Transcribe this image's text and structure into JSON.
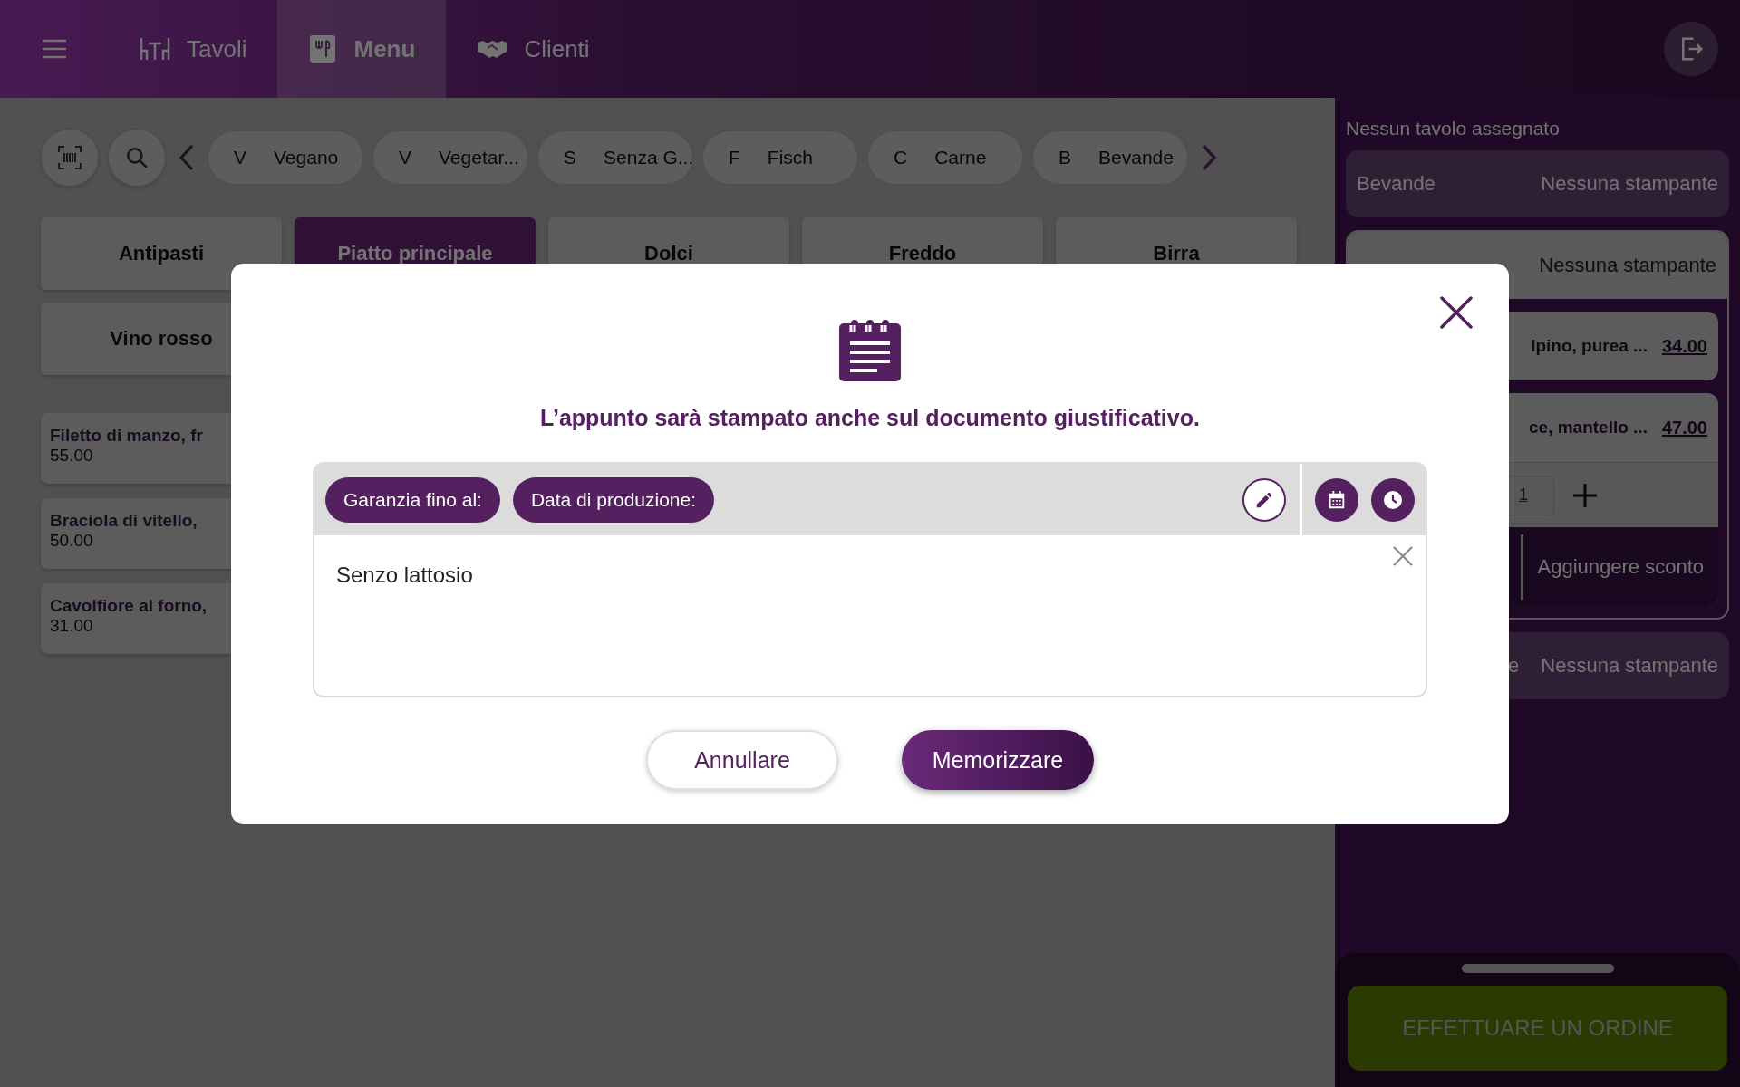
{
  "top_bar": {
    "tabs": [
      {
        "label": "Tavoli",
        "selected": false
      },
      {
        "label": "Menu",
        "selected": true
      },
      {
        "label": "Clienti",
        "selected": false
      }
    ]
  },
  "filters": [
    {
      "letter": "V",
      "label": "Vegano"
    },
    {
      "letter": "V",
      "label": "Vegetar..."
    },
    {
      "letter": "S",
      "label": "Senza G..."
    },
    {
      "letter": "F",
      "label": "Fisch"
    },
    {
      "letter": "C",
      "label": "Carne"
    },
    {
      "letter": "B",
      "label": "Bevande"
    }
  ],
  "categories": [
    {
      "label": "Antipasti",
      "selected": false
    },
    {
      "label": "Piatto principale",
      "selected": true
    },
    {
      "label": "Dolci",
      "selected": false
    },
    {
      "label": "Freddo",
      "selected": false
    },
    {
      "label": "Birra",
      "selected": false
    },
    {
      "label": "Vino rosso",
      "selected": false
    }
  ],
  "menu_items": [
    {
      "name": "Filetto di manzo, fr",
      "price": "55.00"
    },
    {
      "name": "Braciola di vitello,",
      "price": "50.00"
    },
    {
      "name": "Cavolfiore al forno,",
      "price": "31.00"
    }
  ],
  "order_panel": {
    "table_status": "Nessun tavolo assegnato",
    "groups": [
      {
        "name": "Bevande",
        "printer": "Nessuna stampante",
        "expanded": false
      },
      {
        "printer": "Nessuna stampante",
        "expanded": true,
        "items": [
          {
            "name": "lpino, purea ...",
            "price": "34.00"
          },
          {
            "name": "ce, mantello ...",
            "price": "47.00",
            "quantity": "1",
            "discount_label": "Aggiungere sconto"
          }
        ]
      },
      {
        "name": "e",
        "printer": "Nessuna stampante",
        "expanded": false
      }
    ],
    "order_button": "EFFETTUARE UN ORDINE"
  },
  "dialog": {
    "message": "L’appunto sarà stampato anche sul documento giustificativo.",
    "chips": [
      "Garanzia fino al:",
      "Data di produzione:"
    ],
    "note": "Senzo lattosio",
    "buttons": [
      {
        "label": "Annullare",
        "kind": "secondary"
      },
      {
        "label": "Memorizzare",
        "kind": "primary"
      }
    ]
  }
}
